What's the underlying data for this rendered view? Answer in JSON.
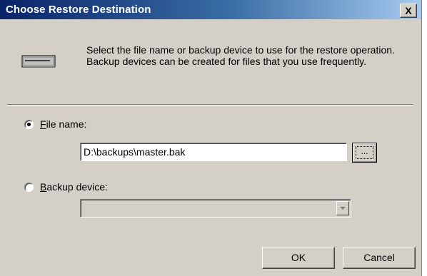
{
  "dialog": {
    "title": "Choose Restore Destination",
    "close_label": "X",
    "description": "Select the file name or backup device to use for the restore operation.  Backup devices can be created for files that you use frequently."
  },
  "file_option": {
    "mnemonic": "F",
    "label_rest": "ile name:",
    "selected": true,
    "value": "D:\\backups\\master.bak",
    "browse_label": "..."
  },
  "device_option": {
    "mnemonic": "B",
    "label_rest": "ackup device:",
    "selected": false,
    "value": ""
  },
  "buttons": {
    "ok": "OK",
    "cancel": "Cancel"
  },
  "colors": {
    "title_start": "#0a246a",
    "title_end": "#a6caf0",
    "face": "#d4d0c8"
  },
  "icons": {
    "drive": "disk-drive-icon",
    "close": "close-icon"
  }
}
